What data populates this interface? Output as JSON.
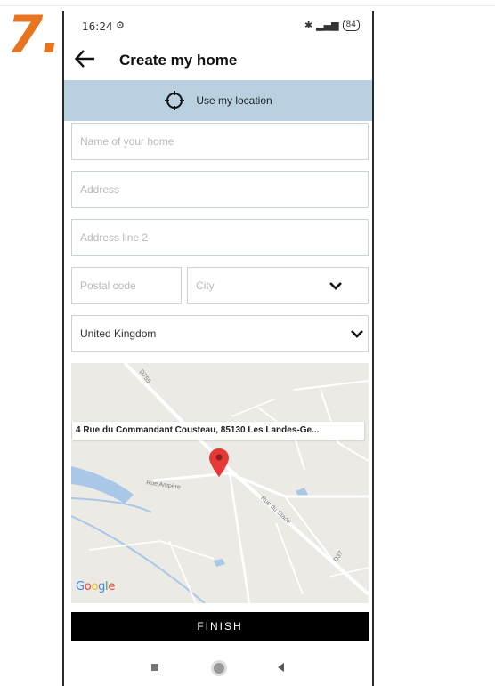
{
  "step_label": "7.",
  "status_bar": {
    "time": "16:24",
    "battery": "84"
  },
  "header": {
    "title": "Create my home"
  },
  "location_button": {
    "label": "Use my location"
  },
  "form": {
    "name_placeholder": "Name of your home",
    "address_placeholder": "Address",
    "address2_placeholder": "Address line 2",
    "postal_placeholder": "Postal code",
    "city_placeholder": "City",
    "country_value": "United Kingdom"
  },
  "map": {
    "address_callout": "4 Rue du Commandant Cousteau, 85130 Les Landes-Ge...",
    "road_labels": [
      "D755",
      "Rue Ampère",
      "Rue du Stade",
      "D37"
    ],
    "provider": "Google"
  },
  "finish_button": {
    "label": "FINISH"
  },
  "colors": {
    "accent_orange": "#e8741f",
    "location_bar": "#b8d0df",
    "pin_red": "#e53935",
    "finish_bg": "#000000"
  },
  "icons": [
    "back-arrow-icon",
    "crosshair-icon",
    "chevron-down-icon",
    "map-pin-icon"
  ]
}
